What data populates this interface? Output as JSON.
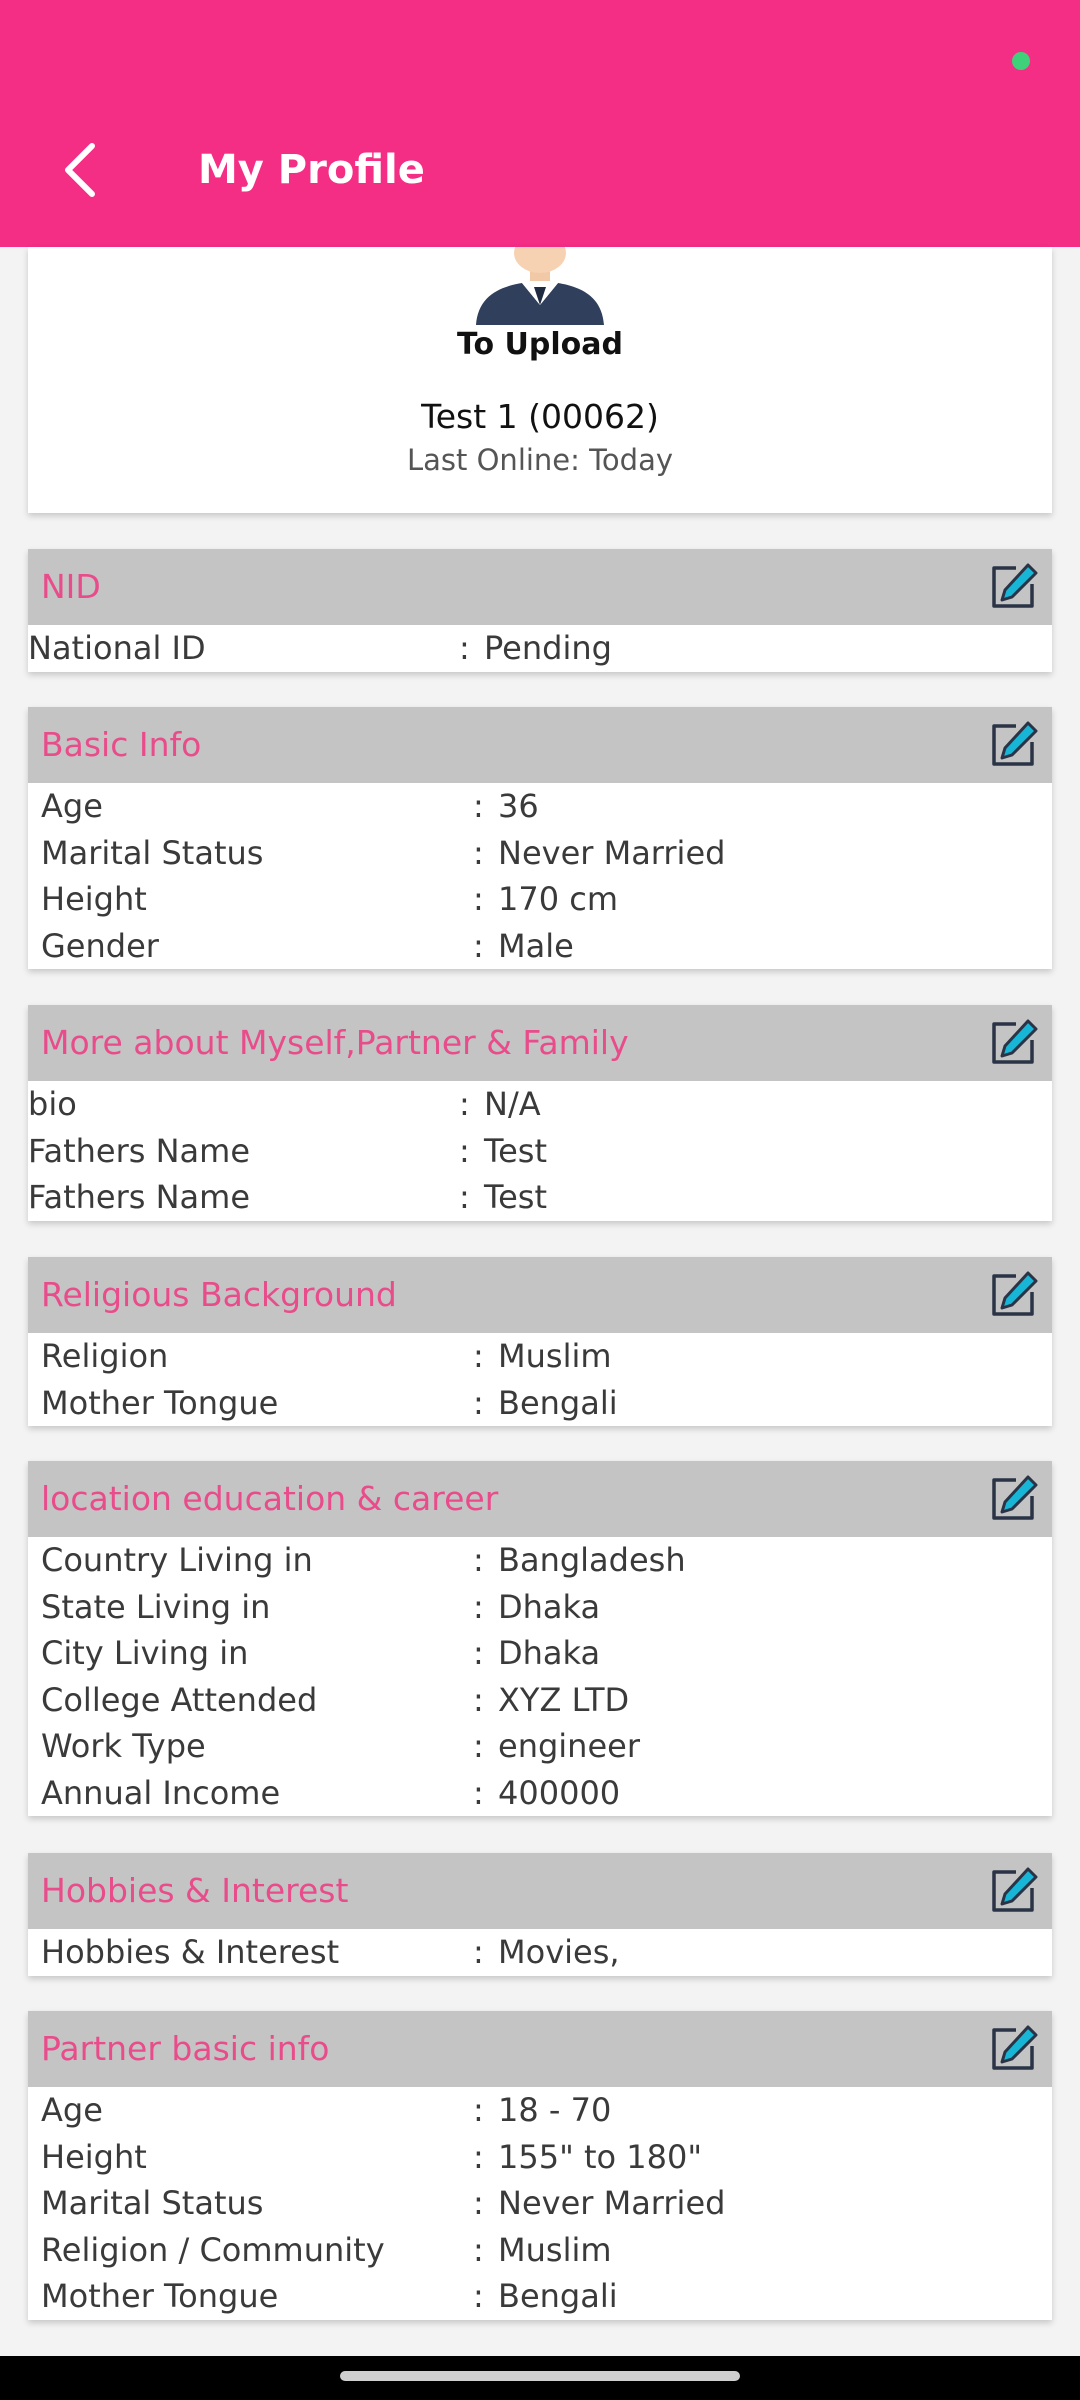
{
  "header": {
    "title": "My Profile",
    "back_icon": "chevron-left-icon",
    "background_color": "#f42d85"
  },
  "profile": {
    "upload_label": "To Upload",
    "name": "Test 1 (00062)",
    "last_online": "Last Online: Today"
  },
  "sections": {
    "nid": {
      "title": "NID",
      "rows": [
        {
          "label": "National ID",
          "value": "Pending"
        }
      ]
    },
    "basic": {
      "title": "Basic Info",
      "rows": [
        {
          "label": "Age",
          "value": "36"
        },
        {
          "label": "Marital Status",
          "value": "Never Married"
        },
        {
          "label": "Height",
          "value": "170 cm"
        },
        {
          "label": "Gender",
          "value": "Male"
        }
      ]
    },
    "more": {
      "title": "More about Myself,Partner & Family",
      "rows": [
        {
          "label": "bio",
          "value": "N/A"
        },
        {
          "label": "Fathers Name",
          "value": "Test"
        },
        {
          "label": "Fathers Name",
          "value": "Test"
        }
      ]
    },
    "religion": {
      "title": "Religious Background",
      "rows": [
        {
          "label": "Religion",
          "value": "Muslim"
        },
        {
          "label": "Mother Tongue",
          "value": "Bengali"
        }
      ]
    },
    "location": {
      "title": "location education & career",
      "rows": [
        {
          "label": "Country Living in",
          "value": "Bangladesh"
        },
        {
          "label": "State Living in",
          "value": "Dhaka"
        },
        {
          "label": "City Living in",
          "value": "Dhaka"
        },
        {
          "label": "College Attended",
          "value": "XYZ LTD"
        },
        {
          "label": "Work Type",
          "value": "engineer"
        },
        {
          "label": "Annual Income",
          "value": "400000"
        }
      ]
    },
    "hobbies": {
      "title": "Hobbies & Interest",
      "rows": [
        {
          "label": "Hobbies & Interest",
          "value": "Movies,"
        }
      ]
    },
    "partner": {
      "title": "Partner basic info",
      "rows": [
        {
          "label": "Age",
          "value": "18 - 70"
        },
        {
          "label": "Height",
          "value": "155\" to 180\""
        },
        {
          "label": "Marital Status",
          "value": "Never Married"
        },
        {
          "label": "Religion / Community",
          "value": "Muslim"
        },
        {
          "label": "Mother Tongue",
          "value": "Bengali"
        }
      ]
    }
  },
  "separator": ":",
  "colors": {
    "section_title": "#e94c8b",
    "section_header_bg": "#c4c4c4",
    "edit_icon_accent": "#18b6d6"
  },
  "edit_icon": "edit-square-pencil-icon"
}
